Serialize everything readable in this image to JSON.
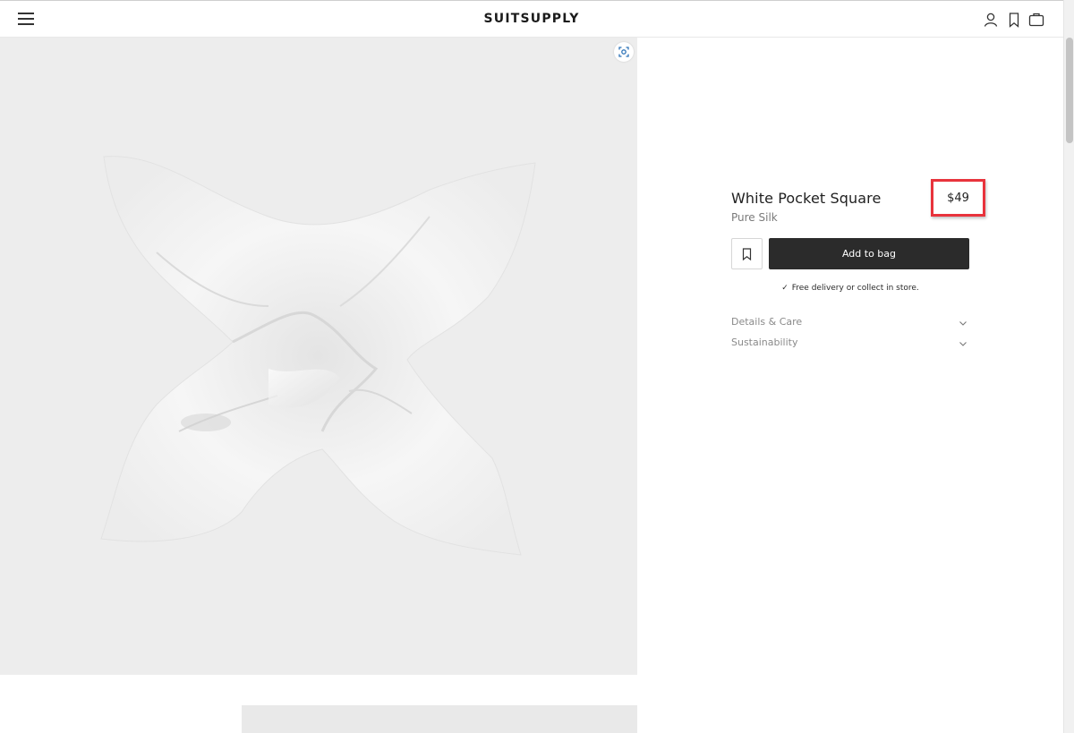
{
  "header": {
    "logo": "SUITSUPPLY",
    "menu_icon": "hamburger-menu-icon",
    "account_icon": "user-icon",
    "wishlist_icon": "bookmark-icon",
    "bag_icon": "shopping-bag-icon"
  },
  "gallery": {
    "zoom_icon": "zoom-scan-icon",
    "image": "white-silk-pocket-square"
  },
  "product": {
    "title": "White Pocket Square",
    "subtitle": "Pure Silk",
    "price": "$49",
    "save_icon": "bookmark-icon",
    "add_to_bag_label": "Add to bag",
    "delivery_note": "Free delivery or collect in store.",
    "accordion": [
      {
        "label": "Details & Care",
        "icon": "chevron-down-icon"
      },
      {
        "label": "Sustainability",
        "icon": "chevron-down-icon"
      }
    ]
  },
  "colors": {
    "accent_highlight": "#e8333c",
    "button_dark": "#2b2b2b",
    "gallery_bg": "#ededed"
  }
}
